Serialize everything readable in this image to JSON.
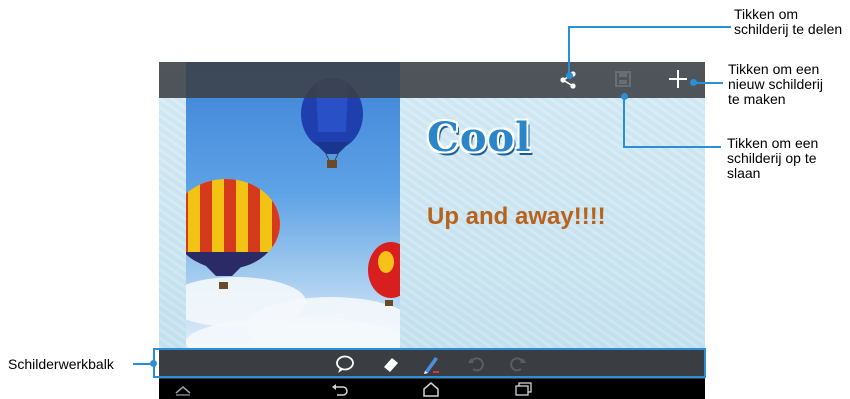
{
  "canvas": {
    "cool_text": "Cool",
    "headline": "Up and away!!!!"
  },
  "callouts": {
    "share": [
      "Tikken om",
      "schilderij te delen"
    ],
    "new": [
      "Tikken om een",
      "nieuw schilderij",
      "te maken"
    ],
    "save": [
      "Tikken om een",
      "schilderij op te",
      "slaan"
    ],
    "toolbar": "Schilderwerkbalk"
  },
  "icons": {
    "topbar": [
      "share-icon",
      "save-icon",
      "add-icon"
    ],
    "toolbar": [
      "speech-bubble-icon",
      "eraser-icon",
      "pen-icon",
      "undo-icon",
      "redo-icon"
    ],
    "navbar": [
      "chevron-up-icon",
      "back-icon",
      "home-icon",
      "recent-apps-icon"
    ]
  },
  "colors": {
    "callout_line": "#2a8fd6",
    "headline": "#b8631c",
    "cool": "#2a86c8"
  }
}
